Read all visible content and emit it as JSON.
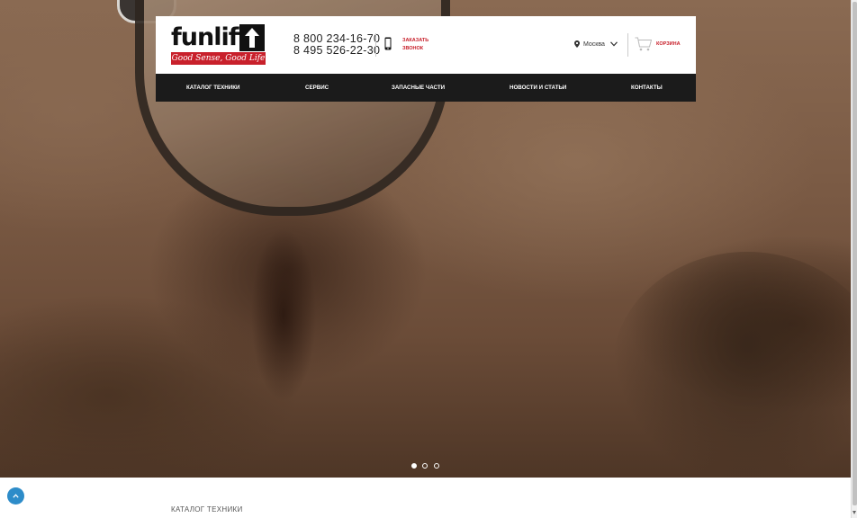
{
  "logo": {
    "word": "funlift",
    "slogan": "Good Sense, Good Life"
  },
  "header": {
    "phones": [
      "8 800 234-16-70",
      "8 495 526-22-30"
    ],
    "callback_lines": [
      "Заказать",
      "звонок"
    ],
    "city": "Москва",
    "cart_label": "Корзина"
  },
  "nav": {
    "items": [
      {
        "label": "Каталог техники"
      },
      {
        "label": "Сервис"
      },
      {
        "label": "Запасные части"
      },
      {
        "label": "Новости и статьи"
      },
      {
        "label": "Контакты"
      }
    ]
  },
  "slider": {
    "dot_count": 3,
    "active_index": 0
  },
  "content": {
    "section_label": "Каталог техники"
  },
  "colors": {
    "accent": "#c8202b",
    "nav_bg": "#1b1b1b",
    "scroll_top": "#2d8cc9"
  },
  "icons": {
    "mobile": "mobile-phone-icon",
    "pin": "location-pin-icon",
    "chevron": "chevron-down-icon",
    "cart": "shopping-cart-icon",
    "scroll_top": "chevron-up-icon"
  }
}
